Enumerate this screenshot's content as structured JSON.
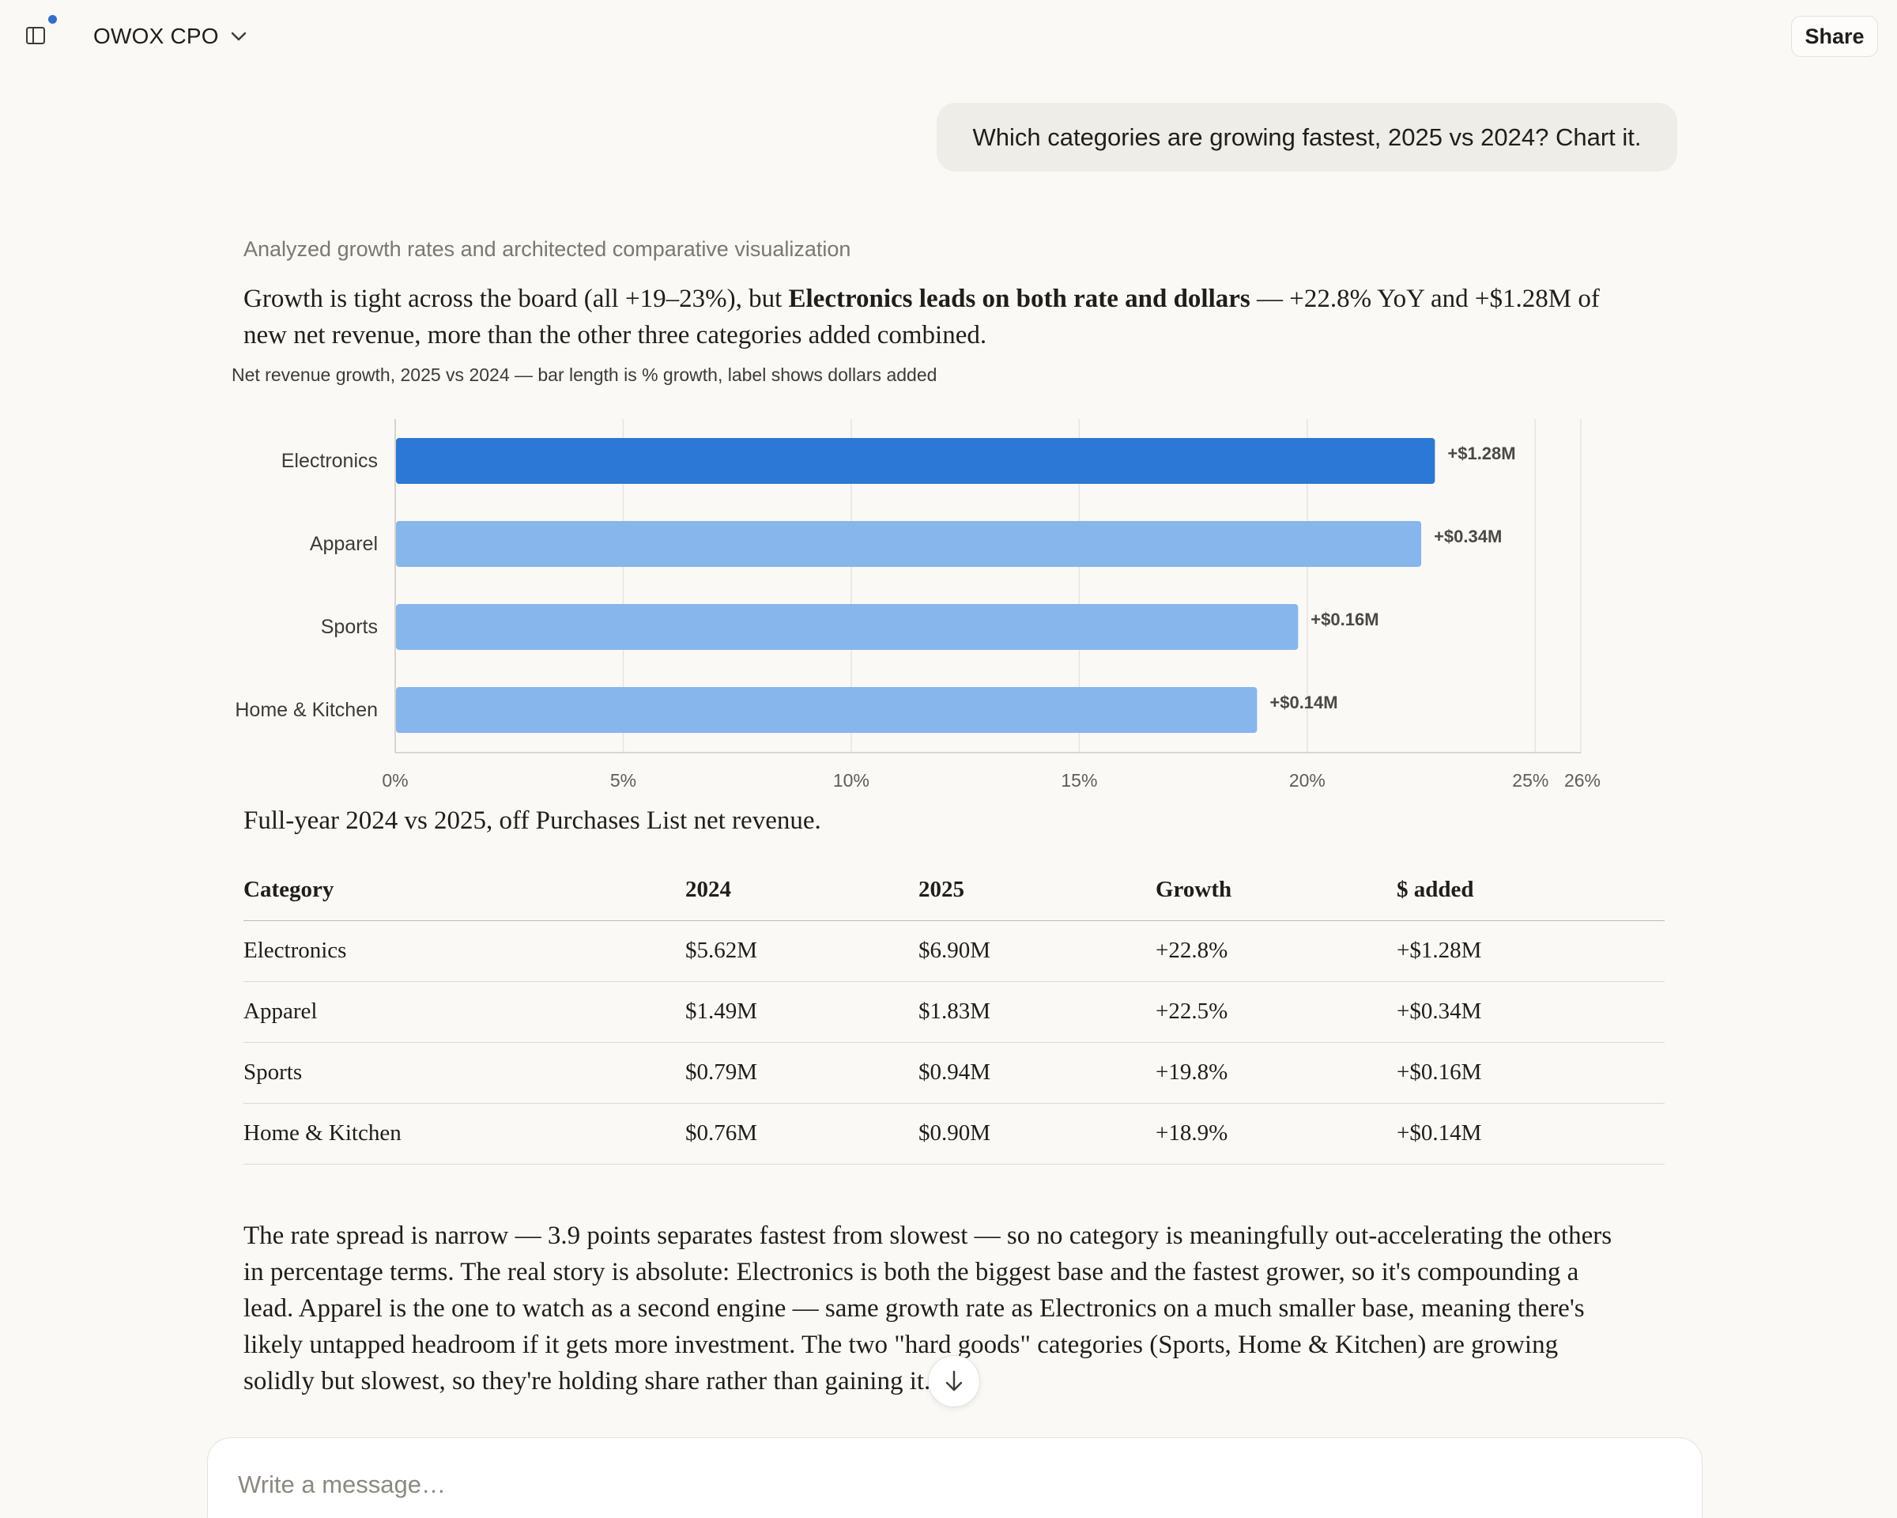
{
  "header": {
    "project_name": "OWOX CPO",
    "share_label": "Share"
  },
  "conversation": {
    "user_message": "Which categories are growing fastest, 2025 vs 2024? Chart it.",
    "thinking_summary": "Analyzed growth rates and architected comparative visualization",
    "lead": {
      "before": "Growth is tight across the board (all +19–23%), but ",
      "bold": "Electronics leads on both rate and dollars",
      "after": " — +22.8% YoY and +$1.28M of new net revenue, more than the other three categories added combined."
    },
    "table_intro": "Full-year 2024 vs 2025, off Purchases List net revenue.",
    "summary": "The rate spread is narrow — 3.9 points separates fastest from slowest — so no category is meaningfully out-accelerating the others in percentage terms. The real story is absolute: Electronics is both the biggest base and the fastest grower, so it's compounding a lead. Apparel is the one to watch as a second engine — same growth rate as Electronics on a much smaller base, meaning there's likely untapped headroom if it gets more investment. The two \"hard goods\" categories (Sports, Home & Kitchen) are growing solidly but slowest, so they're holding share rather than gaining it."
  },
  "chart_data": {
    "type": "bar",
    "orientation": "horizontal",
    "title": "Net revenue growth, 2025 vs 2024 — bar length is % growth, label shows dollars added",
    "categories": [
      "Electronics",
      "Apparel",
      "Sports",
      "Home & Kitchen"
    ],
    "values": [
      22.8,
      22.5,
      19.8,
      18.9
    ],
    "data_labels": [
      "+$1.28M",
      "+$0.34M",
      "+$0.16M",
      "+$0.14M"
    ],
    "highlight_index": 0,
    "xlim": [
      0,
      26
    ],
    "x_ticks": [
      0,
      5,
      10,
      15,
      20,
      25,
      26
    ],
    "x_tick_labels": [
      "0%",
      "5%",
      "10%",
      "15%",
      "20%",
      "25%",
      "26%"
    ],
    "xlabel": "",
    "ylabel": "",
    "grid": "vertical",
    "colors": {
      "highlight": "#2b78d6",
      "default": "#86b6eb"
    }
  },
  "table": {
    "headers": [
      "Category",
      "2024",
      "2025",
      "Growth",
      "$ added"
    ],
    "rows": [
      [
        "Electronics",
        "$5.62M",
        "$6.90M",
        "+22.8%",
        "+$1.28M"
      ],
      [
        "Apparel",
        "$1.49M",
        "$1.83M",
        "+22.5%",
        "+$0.34M"
      ],
      [
        "Sports",
        "$0.79M",
        "$0.94M",
        "+19.8%",
        "+$0.16M"
      ],
      [
        "Home & Kitchen",
        "$0.76M",
        "$0.90M",
        "+18.9%",
        "+$0.14M"
      ]
    ]
  },
  "composer": {
    "placeholder": "Write a message…"
  },
  "icons": {
    "sidebar_toggle": "sidebar-panel-icon",
    "project_dropdown": "chevron-down-icon",
    "scroll_down": "arrow-down-icon"
  },
  "colors": {
    "accent_dot": "#2b6fd4",
    "background": "#faf9f6",
    "user_bubble": "#efede8"
  }
}
